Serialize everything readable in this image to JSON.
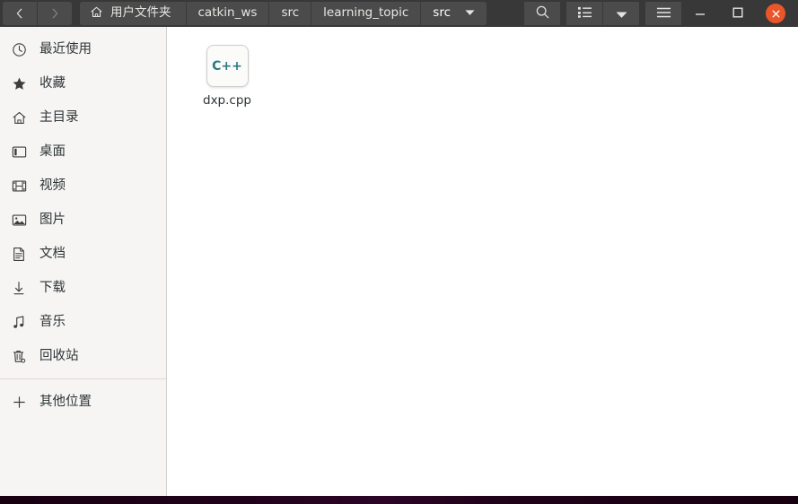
{
  "window": {
    "title": "Files",
    "accent_close_color": "#e9562a",
    "headerbar_color": "#383838",
    "sidebar_color": "#f6f5f4",
    "content_color": "#ffffff"
  },
  "nav": {
    "back_label": "Back",
    "back_icon": "chevron-left-icon",
    "back_enabled": true,
    "forward_label": "Forward",
    "forward_icon": "chevron-right-icon",
    "forward_enabled": false
  },
  "breadcrumb": {
    "home_icon": "home-icon",
    "items": [
      {
        "label": "用户文件夹",
        "icon": "home-icon",
        "current": false
      },
      {
        "label": "catkin_ws",
        "icon": "",
        "current": false
      },
      {
        "label": "src",
        "icon": "",
        "current": false
      },
      {
        "label": "learning_topic",
        "icon": "",
        "current": false
      },
      {
        "label": "src",
        "icon": "",
        "current": true
      }
    ],
    "dropdown_icon": "chevron-down-icon"
  },
  "toolbar": {
    "search_label": "Search",
    "search_icon": "search-icon",
    "view_list_label": "List view",
    "view_list_icon": "list-view-icon",
    "view_options_label": "View options",
    "view_options_icon": "chevron-down-icon",
    "menu_label": "Main menu",
    "menu_icon": "hamburger-menu-icon",
    "minimize_label": "Minimize",
    "minimize_icon": "minimize-icon",
    "maximize_label": "Maximize",
    "maximize_icon": "maximize-icon",
    "close_label": "Close",
    "close_icon": "close-icon"
  },
  "sidebar": {
    "items": [
      {
        "label": "最近使用",
        "icon": "clock-icon"
      },
      {
        "label": "收藏",
        "icon": "star-icon"
      },
      {
        "label": "主目录",
        "icon": "home-icon"
      },
      {
        "label": "桌面",
        "icon": "desktop-icon"
      },
      {
        "label": "视频",
        "icon": "film-icon"
      },
      {
        "label": "图片",
        "icon": "image-icon"
      },
      {
        "label": "文档",
        "icon": "document-icon"
      },
      {
        "label": "下载",
        "icon": "download-icon"
      },
      {
        "label": "音乐",
        "icon": "music-note-icon"
      },
      {
        "label": "回收站",
        "icon": "trash-icon"
      }
    ],
    "other_locations": {
      "label": "其他位置",
      "icon": "plus-icon"
    }
  },
  "content": {
    "files": [
      {
        "name": "dxp.cpp",
        "ext_label": "C++",
        "ext_color": "#2c7a7f",
        "type": "cpp-source-file"
      }
    ]
  }
}
